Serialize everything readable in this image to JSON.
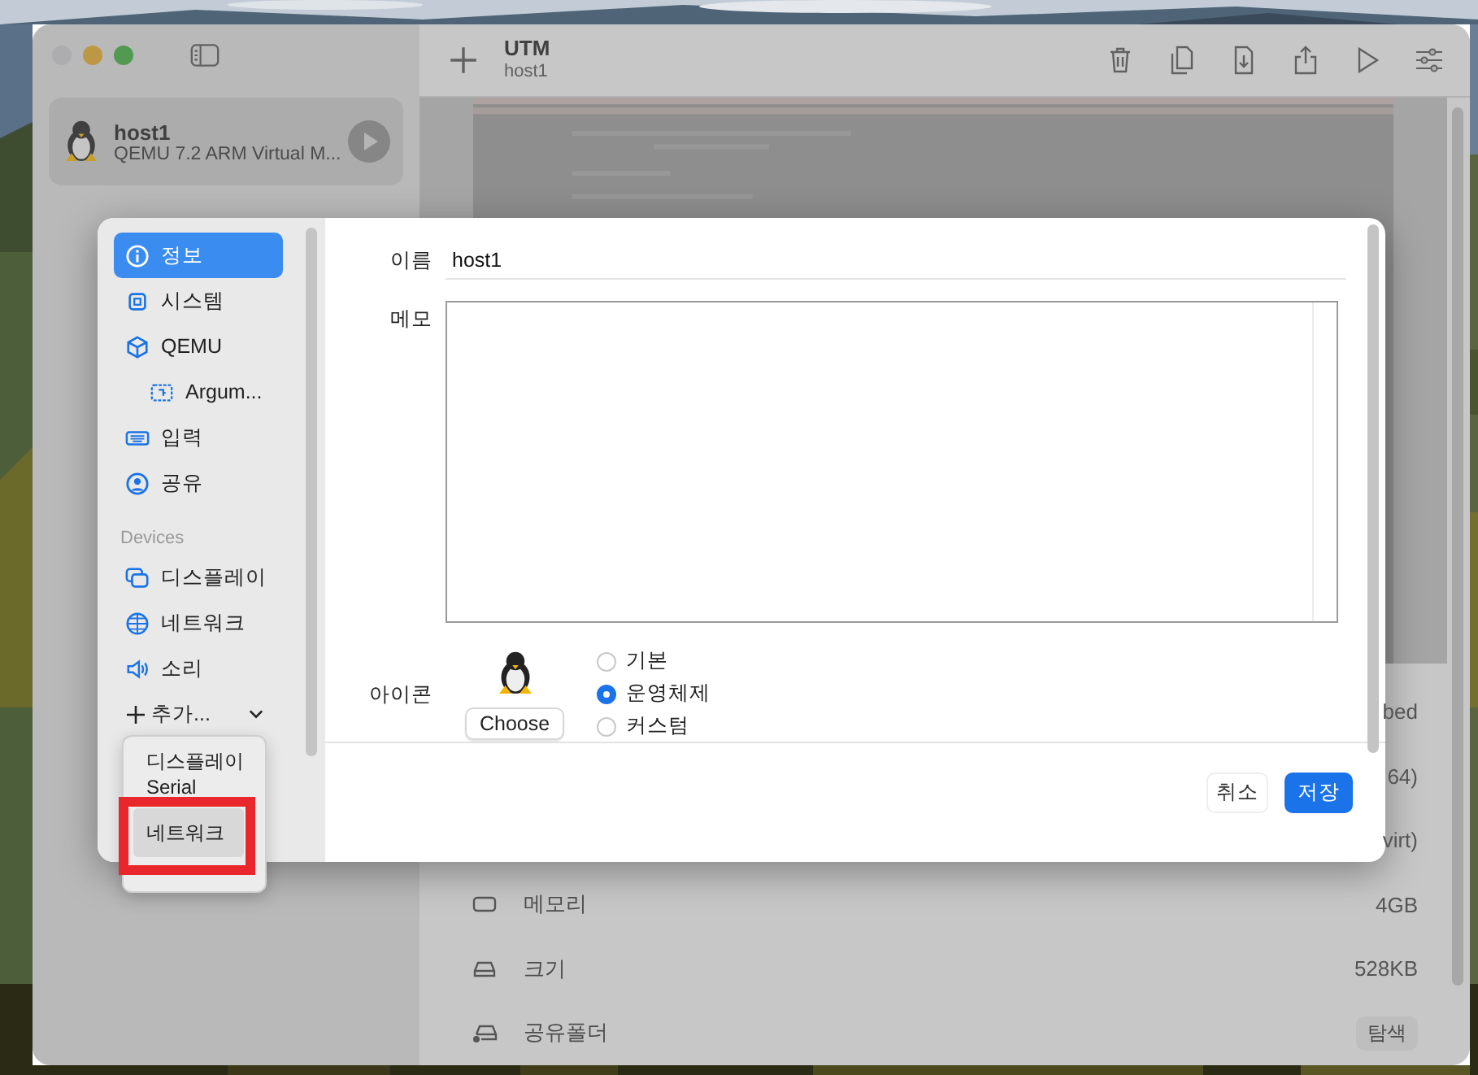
{
  "window": {
    "sidebar": {
      "vm": {
        "name": "host1",
        "subtitle": "QEMU 7.2 ARM Virtual M...",
        "selected": true
      }
    },
    "toolbar": {
      "title": "UTM",
      "subtitle": "host1"
    },
    "details": [
      {
        "value": "bed"
      },
      {
        "value": "64)"
      },
      {
        "value": "virt)"
      },
      {
        "label": "메모리",
        "value": "4GB"
      },
      {
        "label": "크기",
        "value": "528KB"
      },
      {
        "label": "공유폴더",
        "action": "탐색"
      }
    ]
  },
  "dialog": {
    "sidebar": {
      "items": [
        {
          "label": "정보",
          "selected": true
        },
        {
          "label": "시스템",
          "selected": false
        },
        {
          "label": "QEMU",
          "selected": false,
          "children": [
            {
              "label": "Argum...",
              "selected": false
            }
          ]
        },
        {
          "label": "입력",
          "selected": false
        },
        {
          "label": "공유",
          "selected": false
        }
      ],
      "section": "Devices",
      "devices": [
        {
          "label": "디스플레이",
          "selected": false
        },
        {
          "label": "네트워크",
          "selected": false
        },
        {
          "label": "소리",
          "selected": false
        }
      ],
      "add_button": "추가..."
    },
    "form": {
      "name": {
        "label": "이름",
        "value": "host1"
      },
      "memo": {
        "label": "메모"
      },
      "icon": {
        "label": "아이콘",
        "button": "Choose",
        "options": [
          {
            "label": "기본",
            "selected": false
          },
          {
            "label": "운영체제",
            "selected": true
          },
          {
            "label": "커스텀",
            "selected": false
          }
        ]
      }
    },
    "buttons": [
      {
        "label": "취소",
        "kind": "secondary"
      },
      {
        "label": "저장",
        "kind": "primary"
      }
    ]
  },
  "add_menu": {
    "items": [
      {
        "label": "디스플레이",
        "selected": false
      },
      {
        "label": "Serial",
        "selected": false
      },
      {
        "label": "네트워크",
        "selected": true
      }
    ]
  }
}
